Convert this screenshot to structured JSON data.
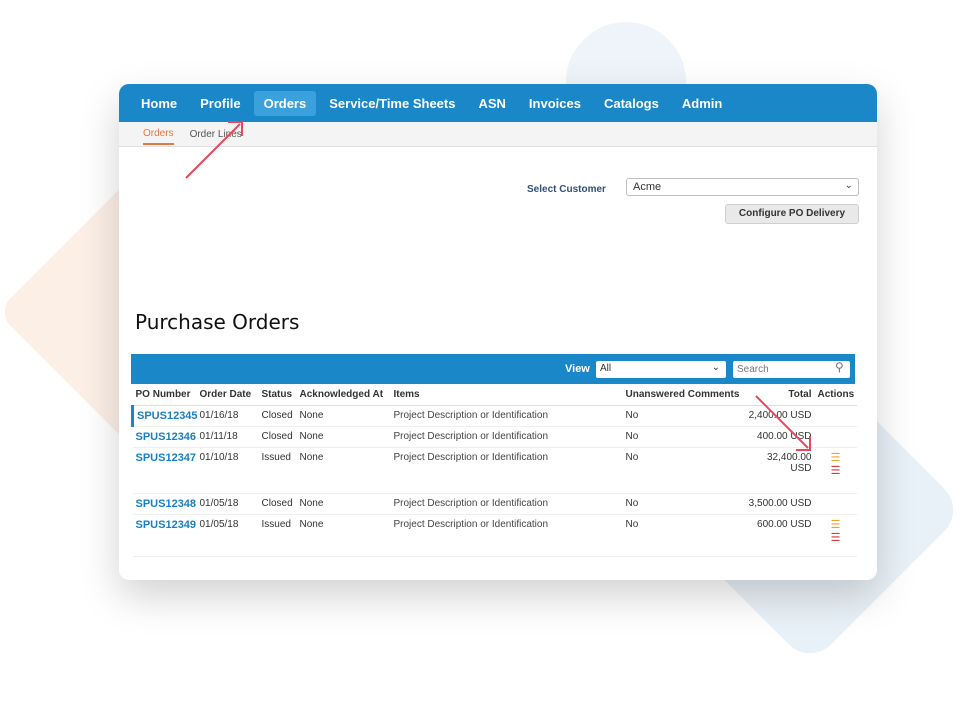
{
  "nav": {
    "items": [
      {
        "label": "Home",
        "active": false
      },
      {
        "label": "Profile",
        "active": false
      },
      {
        "label": "Orders",
        "active": true
      },
      {
        "label": "Service/Time Sheets",
        "active": false
      },
      {
        "label": "ASN",
        "active": false
      },
      {
        "label": "Invoices",
        "active": false
      },
      {
        "label": "Catalogs",
        "active": false
      },
      {
        "label": "Admin",
        "active": false
      }
    ]
  },
  "subnav": {
    "items": [
      {
        "label": "Orders",
        "active": true
      },
      {
        "label": "Order Lines",
        "active": false
      }
    ]
  },
  "customer": {
    "label": "Select Customer",
    "value": "Acme",
    "configure_button": "Configure PO Delivery"
  },
  "page_title": "Purchase Orders",
  "table": {
    "view_label": "View",
    "view_value": "All",
    "search_placeholder": "Search",
    "columns": [
      "PO Number",
      "Order Date",
      "Status",
      "Acknowledged At",
      "Items",
      "Unanswered Comments",
      "Total",
      "Actions"
    ],
    "rows": [
      {
        "po": "SPUS12345",
        "date": "01/16/18",
        "status": "Closed",
        "ack": "None",
        "items": "Project Description or Identification",
        "comments": "No",
        "total": "2,400.00 USD",
        "actions": false
      },
      {
        "po": "SPUS12346",
        "date": "01/11/18",
        "status": "Closed",
        "ack": "None",
        "items": "Project Description or Identification",
        "comments": "No",
        "total": "400.00 USD",
        "actions": false
      },
      {
        "po": "SPUS12347",
        "date": "01/10/18",
        "status": "Issued",
        "ack": "None",
        "items": "Project Description or Identification",
        "comments": "No",
        "total": "32,400.00 USD",
        "actions": true
      },
      {
        "po": "SPUS12348",
        "date": "01/05/18",
        "status": "Closed",
        "ack": "None",
        "items": "Project Description or Identification",
        "comments": "No",
        "total": "3,500.00 USD",
        "actions": false
      },
      {
        "po": "SPUS12349",
        "date": "01/05/18",
        "status": "Issued",
        "ack": "None",
        "items": "Project Description or Identification",
        "comments": "No",
        "total": "600.00 USD",
        "actions": true
      }
    ]
  },
  "colors": {
    "brand_blue": "#1a87c9",
    "active_tab": "#3ba1dc",
    "subnav_accent": "#e07a43",
    "arrow": "#e8485a"
  }
}
